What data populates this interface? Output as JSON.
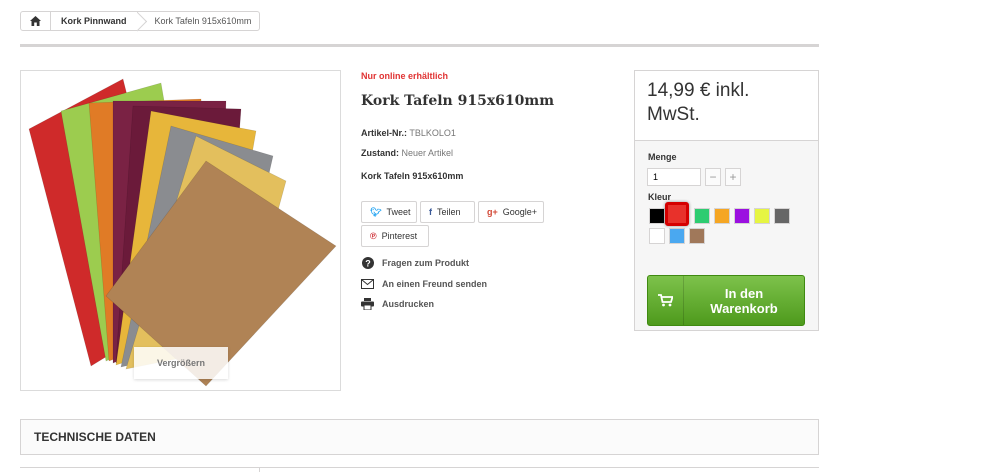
{
  "breadcrumb": {
    "items": [
      "Kork Pinnwand"
    ],
    "current": "Kork Tafeln 915x610mm"
  },
  "image": {
    "zoom_label": "Vergrößern",
    "board_colors": [
      "#cf2a2a",
      "#9ccc4f",
      "#e07b26",
      "#7a2244",
      "#6b1a3a",
      "#e7b63a",
      "#8a8c90",
      "#e3bf5d",
      "#b08355"
    ]
  },
  "product": {
    "online_only": "Nur online erhältlich",
    "title": "Kork Tafeln 915x610mm",
    "ref_label": "Artikel-Nr.:",
    "ref_value": "TBLKOLO1",
    "condition_label": "Zustand:",
    "condition_value": "Neuer Artikel",
    "short_description": "Kork Tafeln 915x610mm"
  },
  "social": {
    "tweet": "Tweet",
    "share": "Teilen",
    "google": "Google+",
    "pinterest": "Pinterest"
  },
  "links": {
    "ask": "Fragen zum Produkt",
    "send_friend": "An einen Freund senden",
    "print": "Ausdrucken"
  },
  "buy": {
    "price_line1": "14,99 € inkl.",
    "price_line2": "MwSt.",
    "qty_label": "Menge",
    "qty_value": "1",
    "color_label": "Kleur",
    "swatches": [
      "#000000",
      "#e8312b",
      "#2ecc71",
      "#f5a623",
      "#9b10e0",
      "#e6f542",
      "#666666",
      "#ffffff",
      "#4aa8f0",
      "#a0785a"
    ],
    "selected_swatch": "#e8312b",
    "cart_line1": "In den",
    "cart_line2": "Warenkorb"
  },
  "tabs": {
    "tech_data": "TECHNISCHE DATEN"
  }
}
